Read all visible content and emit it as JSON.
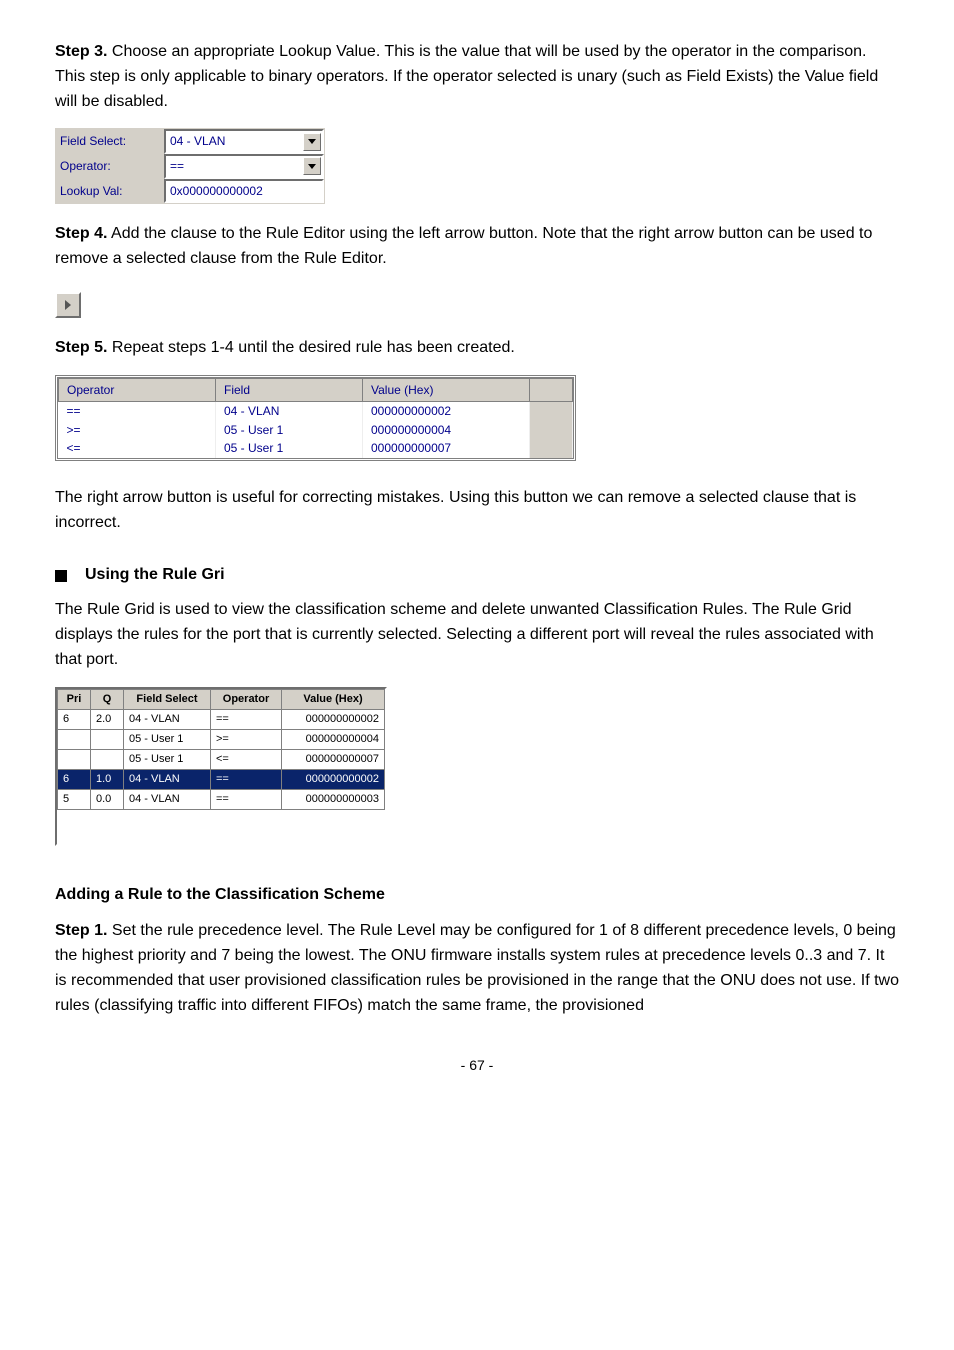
{
  "step3": {
    "label": "Step 3.",
    "text": " Choose an appropriate Lookup Value. This is the value that will be used by the operator in the comparison. This step is only applicable to binary operators. If the operator selected is unary (such as Field Exists) the Value field will be disabled."
  },
  "form": {
    "field_label": "Field Select:",
    "field_value": "04 - VLAN",
    "operator_label": "Operator:",
    "operator_value": "==",
    "lookup_label": "Lookup Val:",
    "lookup_value": "0x000000000002"
  },
  "step4": {
    "label": "Step 4.",
    "text": " Add the clause to the Rule Editor using the left arrow button. Note that the right arrow button can be used to remove a selected clause from the Rule Editor."
  },
  "step5": {
    "label": "Step 5.",
    "text": " Repeat steps 1-4 until the desired rule has been created."
  },
  "ofv": {
    "headers": [
      "Operator",
      "Field",
      "Value (Hex)"
    ],
    "rows": [
      {
        "op": "==",
        "field": "04 - VLAN",
        "val": "000000000002"
      },
      {
        "op": ">=",
        "field": "05 - User 1",
        "val": "000000000004"
      },
      {
        "op": "<=",
        "field": "05 - User 1",
        "val": "000000000007"
      }
    ]
  },
  "right_arrow_text": "The right arrow button is useful for correcting mistakes. Using this button we can remove a selected clause that is incorrect.",
  "using_head": "Using the Rule Gri",
  "using_text": "The Rule Grid is used to view the classification scheme and delete unwanted Classification Rules. The Rule Grid displays the rules for the port that is currently selected. Selecting a different port will reveal the rules associated with that port.",
  "rg": {
    "headers": [
      "Pri",
      "Q",
      "Field Select",
      "Operator",
      "Value (Hex)"
    ],
    "rows": [
      {
        "pri": "6",
        "q": "2.0",
        "fs": "04 - VLAN",
        "op": "==",
        "val": "000000000002",
        "sel": false
      },
      {
        "pri": "",
        "q": "",
        "fs": "05 - User 1",
        "op": ">=",
        "val": "000000000004",
        "sel": false
      },
      {
        "pri": "",
        "q": "",
        "fs": "05 - User 1",
        "op": "<=",
        "val": "000000000007",
        "sel": false
      },
      {
        "pri": "6",
        "q": "1.0",
        "fs": "04 - VLAN",
        "op": "==",
        "val": "000000000002",
        "sel": true
      },
      {
        "pri": "5",
        "q": "0.0",
        "fs": "04 - VLAN",
        "op": "==",
        "val": "000000000003",
        "sel": false
      }
    ]
  },
  "adding_head": "Adding a Rule to the Classification Scheme",
  "adding_step1": {
    "label": "Step 1.",
    "text": " Set the rule precedence level. The Rule Level may be configured for 1 of 8 different precedence levels, 0 being the highest priority and 7 being the lowest. The ONU firmware installs system rules at precedence levels 0..3 and 7. It is recommended that user provisioned classification rules be provisioned in the range that the ONU does not use. If two rules (classifying traffic into different FIFOs) match the same frame, the provisioned"
  },
  "page_number": "- 67 -"
}
